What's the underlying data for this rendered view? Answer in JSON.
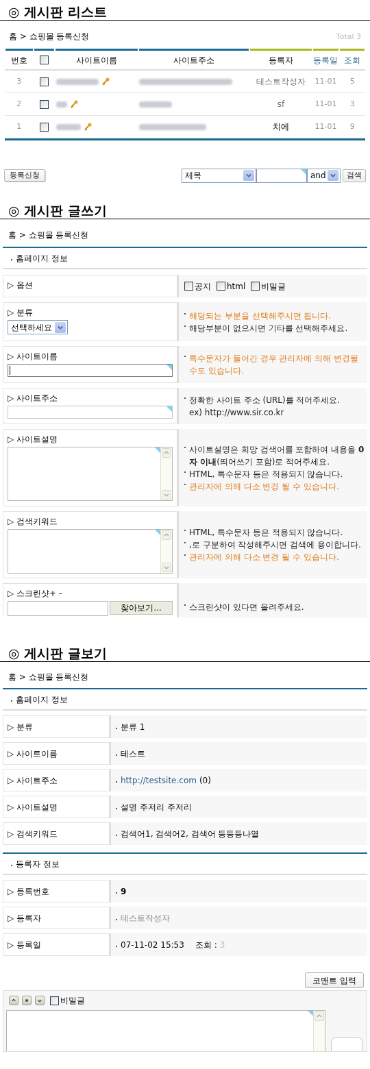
{
  "list": {
    "title": "◎ 게시판 리스트",
    "breadcrumb": "홈 > 쇼핑몰 등록신청",
    "total": "Total 3",
    "columns": [
      {
        "kind": "text",
        "label": "번호",
        "color": "#1b6a94"
      },
      {
        "kind": "checkbox",
        "checked": false,
        "color": "#1b6a94"
      },
      {
        "kind": "text",
        "label": "사이트이름",
        "color": "#1b6a94"
      },
      {
        "kind": "text",
        "label": "사이트주소",
        "color": "#1b6a94"
      },
      {
        "kind": "text",
        "label": "등록자",
        "color": "#a8b91c"
      },
      {
        "kind": "sort",
        "label": "등록일",
        "color": "#a8b91c"
      },
      {
        "kind": "sort",
        "label": "조회",
        "color": "#a8b91c"
      }
    ],
    "rows": [
      {
        "number": "3",
        "checked": false,
        "author": "테스트작성자",
        "bold": false,
        "date": "11-01",
        "views": "5"
      },
      {
        "number": "2",
        "checked": false,
        "author": "sf",
        "bold": false,
        "date": "11-01",
        "views": "3"
      },
      {
        "number": "1",
        "checked": false,
        "author": "치에",
        "bold": true,
        "date": "11-01",
        "views": "9"
      }
    ],
    "register_button": "등록신청",
    "search": {
      "field": "제목",
      "operator": "and",
      "button": "검색"
    }
  },
  "write": {
    "title": "◎ 게시판 글쓰기",
    "breadcrumb": "홈 > 쇼핑몰 등록신청",
    "section": "홈페이지 정보",
    "rows": [
      {
        "kind": "options",
        "label": "▷ 옵션",
        "options": [
          {
            "label": "공지",
            "checked": false
          },
          {
            "label": "html",
            "checked": false
          },
          {
            "label": "비밀글",
            "checked": false
          }
        ],
        "notes": []
      },
      {
        "kind": "select",
        "label": "▷ 분류",
        "value": "선택하세요",
        "notes": [
          {
            "text": "해당되는 부분을 선택해주시면 됩니다.",
            "highlight": true,
            "bullet": true
          },
          {
            "text": "해당부분이 없으시면 기타를 선택해주세요.",
            "highlight": false,
            "bullet": true
          }
        ]
      },
      {
        "kind": "input",
        "label": "▷ 사이트이름",
        "focused": true,
        "notes": [
          {
            "text": "특수문자가 들어간 경우 관리자에 의해 변경될 수도 있습니다.",
            "highlight": true,
            "bullet": true
          }
        ]
      },
      {
        "kind": "input",
        "label": "▷ 사이트주소",
        "focused": false,
        "notes": [
          {
            "text": "정확한 사이트 주소 (URL)를 적어주세요.",
            "highlight": false,
            "bullet": true
          },
          {
            "text": "ex) http://www.sir.co.kr",
            "highlight": false,
            "bullet": false
          }
        ]
      },
      {
        "kind": "textarea",
        "label": "▷ 사이트설명",
        "notes": [
          {
            "text": "사이트설명은 희망 검색어를 포함하여 내용을 **0자 이내**(띄어쓰기 포함)로 적어주세요.",
            "highlight": false,
            "bullet": true
          },
          {
            "text": "HTML, 특수문자 등은 적용되지 않습니다.",
            "highlight": false,
            "bullet": true
          },
          {
            "text": "관리자에 의해 다소 변경 될 수 있습니다.",
            "highlight": true,
            "bullet": true
          }
        ]
      },
      {
        "kind": "textarea",
        "label": "▷ 검색키워드",
        "notes": [
          {
            "text": "HTML, 특수문자 등은 적용되지 않습니다.",
            "highlight": false,
            "bullet": true
          },
          {
            "text": ",로 구분하여 작성해주시면 검색에 용이합니다.",
            "highlight": false,
            "bullet": true
          },
          {
            "text": "관리자에 의해 다소 변경 될 수 있습니다.",
            "highlight": true,
            "bullet": true
          }
        ]
      },
      {
        "kind": "file",
        "label": "▷ 스크린샷+ -",
        "button": "찾아보기...",
        "notes": [
          {
            "text": "스크린샷이 있다면 올려주세요.",
            "highlight": false,
            "bullet": true
          }
        ]
      }
    ]
  },
  "view": {
    "title": "◎ 게시판 글보기",
    "breadcrumb": "홈 > 쇼핑몰 등록신청",
    "sections": [
      {
        "title": "홈페이지 정보",
        "rows": [
          {
            "kind": "text",
            "label": "▷ 분류",
            "value": "분류 1"
          },
          {
            "kind": "text",
            "label": "▷ 사이트이름",
            "value": "테스트"
          },
          {
            "kind": "link",
            "label": "▷ 사이트주소",
            "value": "http://testsite.com",
            "suffix": "(0)"
          },
          {
            "kind": "text",
            "label": "▷ 사이트설명",
            "value": "설명 주저리 주저리"
          },
          {
            "kind": "text",
            "label": "▷ 검색키워드",
            "value": "검색어1, 검색어2, 검색어 등등등나열"
          }
        ]
      },
      {
        "title": "등록자 정보",
        "rows": [
          {
            "kind": "bold",
            "label": "▷ 등록번호",
            "value": "9"
          },
          {
            "kind": "muted",
            "label": "▷ 등록자",
            "value": "테스트작성자"
          },
          {
            "kind": "date",
            "label": "▷ 등록일",
            "value": "07-11-02 15:53",
            "views_label": "조회 :",
            "views": "3"
          }
        ]
      }
    ]
  },
  "comment": {
    "button": "코맨트 입력",
    "secret": {
      "label": "비밀글",
      "checked": false
    }
  }
}
